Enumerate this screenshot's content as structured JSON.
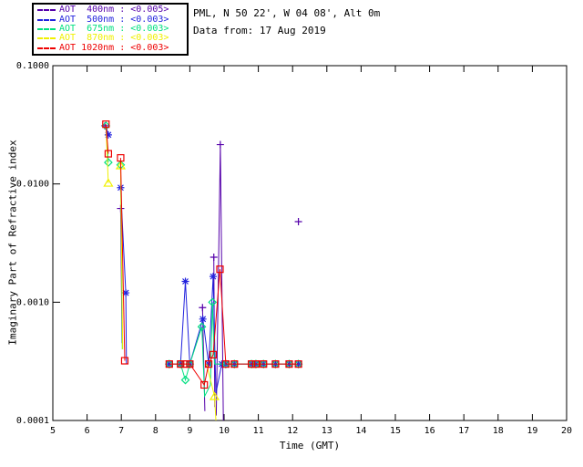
{
  "header": {
    "site": "PML, N 50 22', W 04 08', Alt 0m",
    "data_from": "Data from: 17 Aug 2019"
  },
  "legend": {
    "entries": [
      {
        "label": "AOT  400nm : <0.005>",
        "color": "#5500aa"
      },
      {
        "label": "AOT  500nm : <0.003>",
        "color": "#2222dd"
      },
      {
        "label": "AOT  675nm : <0.003>",
        "color": "#00e080"
      },
      {
        "label": "AOT  870nm : <0.003>",
        "color": "#f0f000"
      },
      {
        "label": "AOT 1020nm : <0.003>",
        "color": "#ee0000"
      }
    ]
  },
  "chart_data": {
    "type": "line",
    "xlabel": "Time (GMT)",
    "ylabel": "Imaginary Part of Refractive index",
    "xlim": [
      5,
      20
    ],
    "ylim": [
      0.0001,
      0.1
    ],
    "yscale": "log",
    "grid": false,
    "x_ticks": [
      5,
      6,
      7,
      8,
      9,
      10,
      11,
      12,
      13,
      14,
      15,
      16,
      17,
      18,
      19,
      20
    ],
    "y_ticks": [
      {
        "value": 0.1,
        "label": "0.1000"
      },
      {
        "value": 0.01,
        "label": "0.0100"
      },
      {
        "value": 0.001,
        "label": "0.0010"
      },
      {
        "value": 0.0001,
        "label": "0.0001"
      }
    ],
    "series": [
      {
        "name": "AOT 400nm",
        "threshold": "<0.005>",
        "color": "#5500aa",
        "marker": "plus",
        "segments": [
          [
            [
              6.52,
              0.031
            ]
          ],
          [
            [
              6.98,
              0.0062
            ],
            [
              7.02,
              0.00045
            ]
          ],
          [
            [
              9.37,
              0.0009
            ],
            [
              9.44,
              0.00012
            ]
          ],
          [
            [
              9.7,
              0.0024
            ],
            [
              9.73,
              0.00013
            ]
          ],
          [
            [
              9.77,
              0.00011
            ],
            [
              9.89,
              0.0215
            ],
            [
              9.98,
              0.0001
            ]
          ],
          [
            [
              12.17,
              0.0048
            ]
          ]
        ],
        "markers": [
          [
            6.52,
            0.031
          ],
          [
            6.98,
            0.0062
          ],
          [
            9.37,
            0.0009
          ],
          [
            9.7,
            0.0024
          ],
          [
            9.89,
            0.0215
          ],
          [
            12.17,
            0.0048
          ]
        ]
      },
      {
        "name": "AOT 500nm",
        "threshold": "<0.003>",
        "color": "#2222dd",
        "marker": "asterisk",
        "segments": [
          [
            [
              6.55,
              0.031
            ],
            [
              6.62,
              0.026
            ]
          ],
          [
            [
              6.98,
              0.0093
            ],
            [
              7.13,
              0.0012
            ],
            [
              7.15,
              0.0003
            ]
          ],
          [
            [
              8.4,
              0.0003
            ],
            [
              8.73,
              0.0003
            ],
            [
              8.87,
              0.0015
            ],
            [
              9.0,
              0.0003
            ],
            [
              9.38,
              0.00072
            ],
            [
              9.55,
              0.0003
            ],
            [
              9.68,
              0.00165
            ],
            [
              9.76,
              0.00017
            ],
            [
              9.93,
              0.0003
            ],
            [
              10.05,
              0.0003
            ],
            [
              10.3,
              0.0003
            ],
            [
              10.8,
              0.0003
            ],
            [
              10.93,
              0.0003
            ],
            [
              11.15,
              0.0003
            ],
            [
              11.5,
              0.0003
            ],
            [
              11.9,
              0.0003
            ],
            [
              12.17,
              0.0003
            ]
          ]
        ],
        "markers": [
          [
            6.62,
            0.026
          ],
          [
            6.98,
            0.0093
          ],
          [
            7.13,
            0.0012
          ],
          [
            8.4,
            0.0003
          ],
          [
            8.73,
            0.0003
          ],
          [
            8.87,
            0.0015
          ],
          [
            9.0,
            0.0003
          ],
          [
            9.38,
            0.00072
          ],
          [
            9.55,
            0.0003
          ],
          [
            9.68,
            0.00165
          ],
          [
            9.93,
            0.0003
          ],
          [
            10.05,
            0.0003
          ],
          [
            10.3,
            0.0003
          ],
          [
            10.8,
            0.0003
          ],
          [
            10.93,
            0.0003
          ],
          [
            11.15,
            0.0003
          ],
          [
            11.5,
            0.0003
          ],
          [
            11.9,
            0.0003
          ],
          [
            12.17,
            0.0003
          ]
        ]
      },
      {
        "name": "AOT 675nm",
        "threshold": "<0.003>",
        "color": "#00e080",
        "marker": "diamond",
        "segments": [
          [
            [
              6.55,
              0.031
            ],
            [
              6.62,
              0.0152
            ]
          ],
          [
            [
              6.98,
              0.0145
            ],
            [
              7.03,
              0.0004
            ]
          ],
          [
            [
              8.4,
              0.0003
            ],
            [
              8.73,
              0.0003
            ],
            [
              8.87,
              0.00022
            ],
            [
              9.0,
              0.0003
            ],
            [
              9.35,
              0.00062
            ],
            [
              9.43,
              0.00016
            ],
            [
              9.6,
              0.0002
            ],
            [
              9.66,
              0.001
            ],
            [
              9.72,
              0.0003
            ],
            [
              10.05,
              0.0003
            ],
            [
              10.3,
              0.0003
            ],
            [
              10.8,
              0.0003
            ],
            [
              10.93,
              0.0003
            ],
            [
              11.15,
              0.0003
            ],
            [
              11.5,
              0.0003
            ],
            [
              11.9,
              0.0003
            ],
            [
              12.17,
              0.0003
            ]
          ]
        ],
        "markers": [
          [
            6.55,
            0.031
          ],
          [
            6.62,
            0.0152
          ],
          [
            6.98,
            0.0145
          ],
          [
            8.4,
            0.0003
          ],
          [
            8.73,
            0.0003
          ],
          [
            8.87,
            0.00022
          ],
          [
            9.0,
            0.0003
          ],
          [
            9.35,
            0.00062
          ],
          [
            9.66,
            0.001
          ],
          [
            10.05,
            0.0003
          ],
          [
            10.3,
            0.0003
          ],
          [
            10.8,
            0.0003
          ],
          [
            10.93,
            0.0003
          ],
          [
            11.15,
            0.0003
          ],
          [
            11.5,
            0.0003
          ],
          [
            11.9,
            0.0003
          ],
          [
            12.17,
            0.0003
          ]
        ]
      },
      {
        "name": "AOT 870nm",
        "threshold": "<0.003>",
        "color": "#f0f000",
        "marker": "triangle",
        "segments": [
          [
            [
              6.55,
              0.031
            ],
            [
              6.62,
              0.0102
            ]
          ],
          [
            [
              6.98,
              0.0143
            ],
            [
              7.04,
              0.0004
            ]
          ],
          [
            [
              9.49,
              0.0003
            ],
            [
              9.72,
              0.00016
            ],
            [
              9.76,
              0.0001
            ]
          ]
        ],
        "markers": [
          [
            6.62,
            0.0102
          ],
          [
            6.98,
            0.0143
          ],
          [
            9.72,
            0.00016
          ]
        ]
      },
      {
        "name": "AOT 1020nm",
        "threshold": "<0.003>",
        "color": "#ee0000",
        "marker": "square",
        "segments": [
          [
            [
              6.55,
              0.032
            ],
            [
              6.62,
              0.018
            ]
          ],
          [
            [
              6.98,
              0.0166
            ],
            [
              7.1,
              0.00032
            ]
          ],
          [
            [
              8.4,
              0.0003
            ],
            [
              8.73,
              0.0003
            ],
            [
              8.87,
              0.0003
            ],
            [
              9.0,
              0.0003
            ],
            [
              9.42,
              0.0002
            ],
            [
              9.55,
              0.0003
            ],
            [
              9.68,
              0.00036
            ],
            [
              9.88,
              0.0019
            ],
            [
              10.05,
              0.0003
            ],
            [
              10.3,
              0.0003
            ],
            [
              10.8,
              0.0003
            ],
            [
              10.93,
              0.0003
            ],
            [
              11.15,
              0.0003
            ],
            [
              11.5,
              0.0003
            ],
            [
              11.9,
              0.0003
            ],
            [
              12.17,
              0.0003
            ]
          ]
        ],
        "markers": [
          [
            6.55,
            0.032
          ],
          [
            6.62,
            0.018
          ],
          [
            6.98,
            0.0166
          ],
          [
            7.1,
            0.00032
          ],
          [
            8.4,
            0.0003
          ],
          [
            8.73,
            0.0003
          ],
          [
            8.87,
            0.0003
          ],
          [
            9.0,
            0.0003
          ],
          [
            9.42,
            0.0002
          ],
          [
            9.55,
            0.0003
          ],
          [
            9.68,
            0.00036
          ],
          [
            9.88,
            0.0019
          ],
          [
            10.05,
            0.0003
          ],
          [
            10.3,
            0.0003
          ],
          [
            10.8,
            0.0003
          ],
          [
            10.93,
            0.0003
          ],
          [
            11.15,
            0.0003
          ],
          [
            11.5,
            0.0003
          ],
          [
            11.9,
            0.0003
          ],
          [
            12.17,
            0.0003
          ]
        ]
      }
    ]
  }
}
